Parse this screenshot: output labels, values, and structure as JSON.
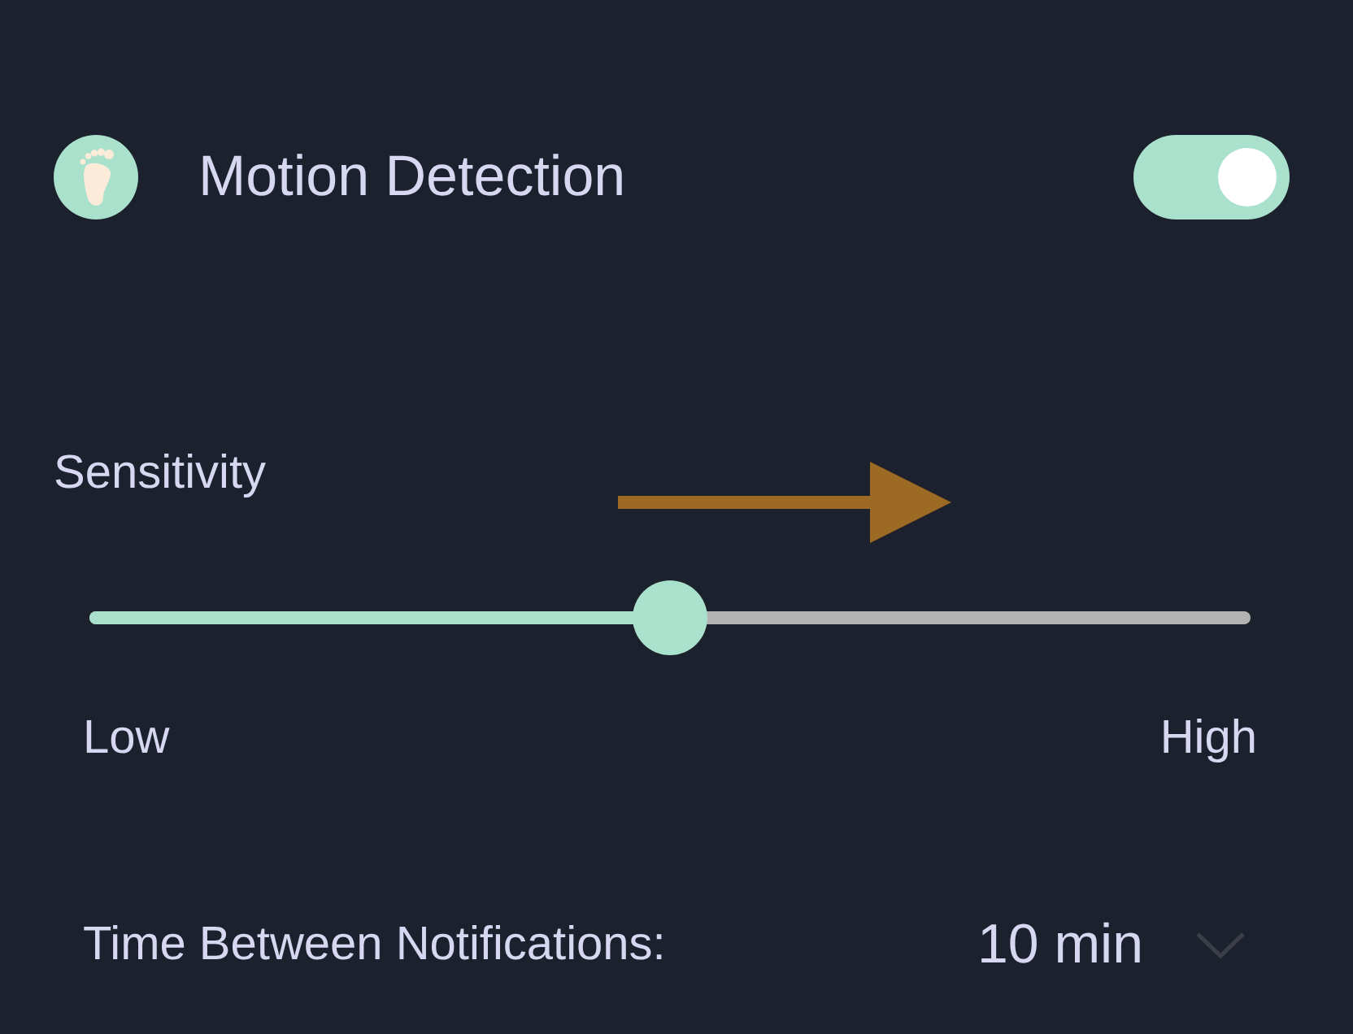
{
  "header": {
    "title": "Motion Detection",
    "on": true
  },
  "sensitivity": {
    "label": "Sensitivity",
    "level": 0.5,
    "min_label": "Low",
    "max_label": "High"
  },
  "notification_interval": {
    "label": "Time Between Notifications:",
    "value": "10 min"
  }
}
